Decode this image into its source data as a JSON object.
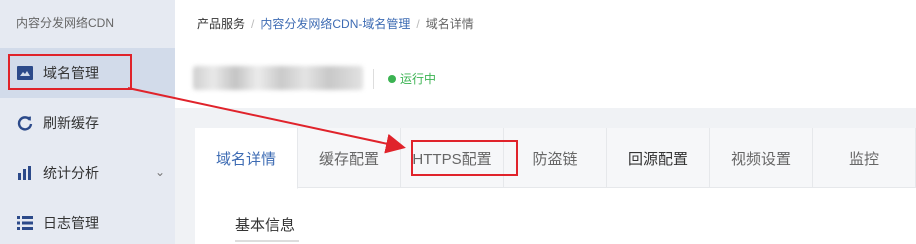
{
  "sidebar": {
    "title": "内容分发网络CDN",
    "items": [
      {
        "label": "域名管理",
        "icon": "domain-icon"
      },
      {
        "label": "刷新缓存",
        "icon": "refresh-icon"
      },
      {
        "label": "统计分析",
        "icon": "bar-chart-icon"
      },
      {
        "label": "日志管理",
        "icon": "list-icon"
      }
    ]
  },
  "breadcrumb": {
    "root": "产品服务",
    "parent": "内容分发网络CDN-域名管理",
    "current": "域名详情",
    "separator": "/"
  },
  "domain": {
    "status": "运行中",
    "status_color": "#3bb352"
  },
  "tabs": [
    "域名详情",
    "缓存配置",
    "HTTPS配置",
    "防盗链",
    "回源配置",
    "视频设置",
    "监控"
  ],
  "section": {
    "title": "基本信息"
  },
  "colors": {
    "accent": "#3d6bb3",
    "annotation": "#e0232b"
  }
}
